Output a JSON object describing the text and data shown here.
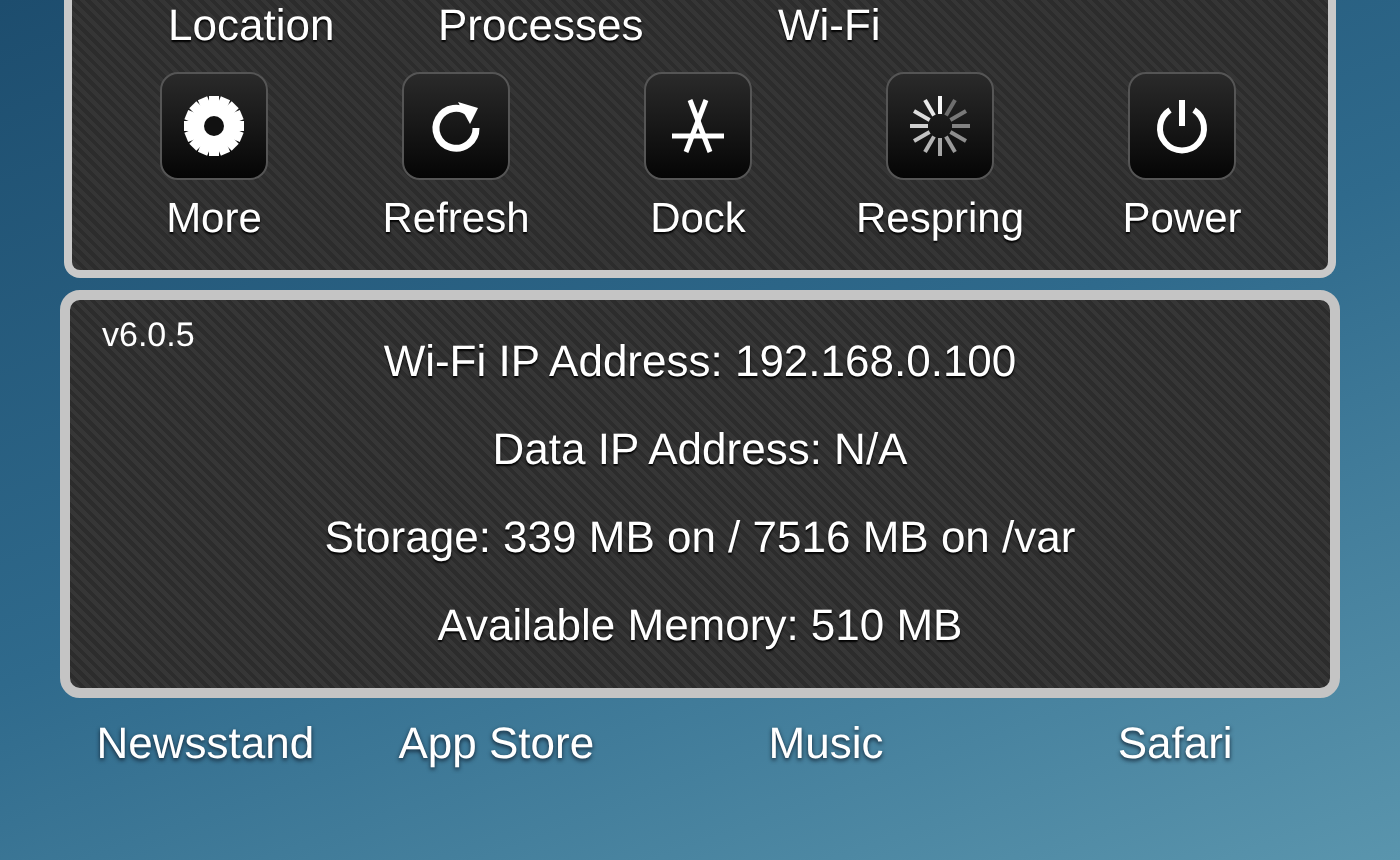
{
  "toggles": [
    {
      "label": "Location"
    },
    {
      "label": "Processes"
    },
    {
      "label": "Wi-Fi"
    }
  ],
  "buttons": [
    {
      "label": "More",
      "kind": "gear"
    },
    {
      "label": "Refresh",
      "kind": "refresh"
    },
    {
      "label": "Dock",
      "kind": "appstore"
    },
    {
      "label": "Respring",
      "kind": "spinner"
    },
    {
      "label": "Power",
      "kind": "power"
    }
  ],
  "info": {
    "version": "v6.0.5",
    "lines": [
      "Wi-Fi IP Address: 192.168.0.100",
      "Data IP Address: N/A",
      "Storage: 339 MB on / 7516 MB on /var",
      "Available Memory: 510 MB"
    ]
  },
  "home_apps": [
    {
      "label": "Newsstand"
    },
    {
      "label": "App Store"
    },
    {
      "label": "Music"
    },
    {
      "label": "Safari"
    }
  ]
}
